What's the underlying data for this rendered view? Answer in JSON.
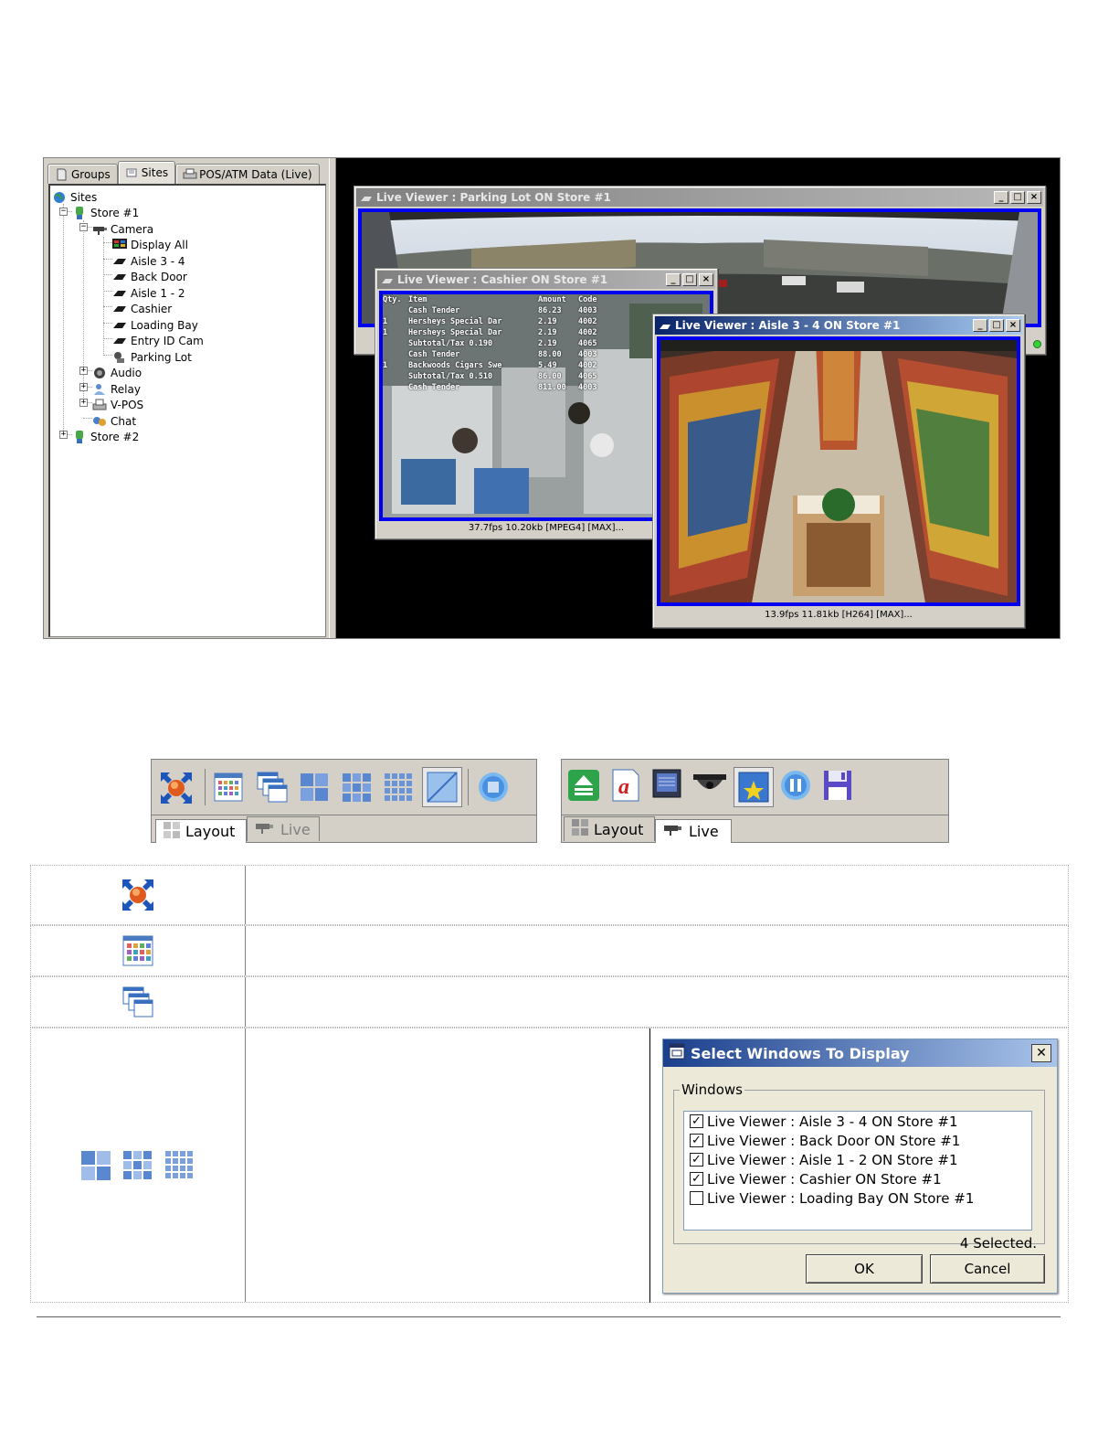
{
  "tree_tabs": [
    {
      "label": "Groups",
      "active": false
    },
    {
      "label": "Sites",
      "active": true
    },
    {
      "label": "POS/ATM Data (Live)",
      "active": false
    }
  ],
  "tree": {
    "root": "Sites",
    "store1": "Store #1",
    "camera": "Camera",
    "cameras": [
      "Display All",
      "Aisle 3 - 4",
      "Back Door",
      "Aisle 1 - 2",
      "Cashier",
      "Loading Bay",
      "Entry ID Cam",
      "Parking Lot"
    ],
    "audio": "Audio",
    "relay": "Relay",
    "vpos": "V-POS",
    "chat": "Chat",
    "store2": "Store #2"
  },
  "windows": {
    "parking": {
      "title": "Live Viewer : Parking Lot ON Store #1"
    },
    "cashier": {
      "title": "Live Viewer : Cashier ON Store #1",
      "status": "37.7fps 10.20kb [MPEG4] [MAX]...",
      "pos_header": [
        "Qty.",
        "Item",
        "Amount",
        "Code"
      ],
      "pos_lines": [
        [
          "",
          "Cash Tender",
          "86.23",
          "4003"
        ],
        [
          "1",
          "Hersheys Special Dar",
          "2.19",
          "4002"
        ],
        [
          "1",
          "Hersheys Special Dar",
          "2.19",
          "4002"
        ],
        [
          "",
          "Subtotal/Tax 0.190",
          "2.19",
          "4065"
        ],
        [
          "",
          "Cash Tender",
          "88.00",
          "4003"
        ],
        [
          "1",
          "Backwoods Cigars Swe",
          "5.49",
          "4002"
        ],
        [
          "",
          "Subtotal/Tax 0.510",
          "86.00",
          "4065"
        ],
        [
          "",
          "Cash Tender",
          "811.00",
          "4003"
        ]
      ]
    },
    "aisle": {
      "title": "Live Viewer : Aisle 3 - 4 ON Store #1",
      "status": "13.9fps 11.81kb [H264] [MAX]..."
    }
  },
  "toolbar_left": {
    "tab_layout": "Layout",
    "tab_live": "Live"
  },
  "toolbar_right": {
    "tab_layout": "Layout",
    "tab_live": "Live"
  },
  "dialog": {
    "title": "Select Windows To Display",
    "group_label": "Windows",
    "items": [
      {
        "label": "Live Viewer : Aisle 3 - 4 ON Store #1",
        "checked": true
      },
      {
        "label": "Live Viewer : Back Door ON Store #1",
        "checked": true
      },
      {
        "label": "Live Viewer : Aisle 1 - 2 ON Store #1",
        "checked": true
      },
      {
        "label": "Live Viewer : Cashier ON Store #1",
        "checked": true
      },
      {
        "label": "Live Viewer : Loading Bay ON Store #1",
        "checked": false
      }
    ],
    "selected_count": "4 Selected.",
    "ok": "OK",
    "cancel": "Cancel"
  },
  "colors": {
    "video_border": "#0000ee",
    "active_title": "#0a246a",
    "desktop": "#000000"
  }
}
